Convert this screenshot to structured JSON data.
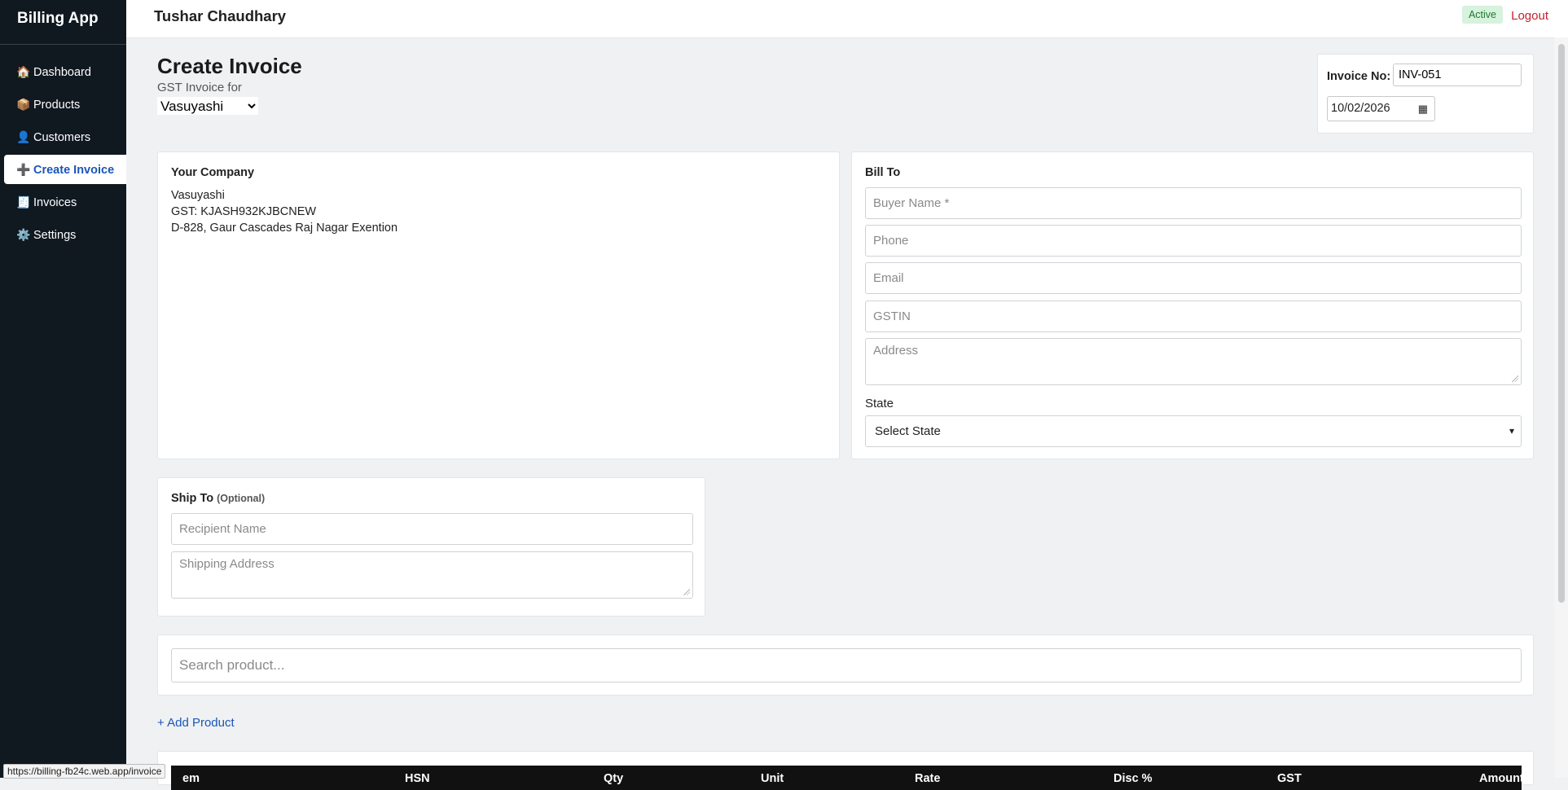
{
  "sidebar": {
    "brand": "Billing App",
    "items": [
      {
        "icon": "🏠",
        "label": "Dashboard"
      },
      {
        "icon": "📦",
        "label": "Products"
      },
      {
        "icon": "👤",
        "label": "Customers"
      },
      {
        "icon": "➕",
        "label": "Create Invoice"
      },
      {
        "icon": "🧾",
        "label": "Invoices"
      },
      {
        "icon": "⚙️",
        "label": "Settings"
      }
    ]
  },
  "header": {
    "user_name": "Tushar Chaudhary",
    "status": "Active",
    "logout_label": "Logout"
  },
  "page": {
    "title": "Create Invoice",
    "subtitle": "GST Invoice for",
    "company_selected": "Vasuyashi"
  },
  "invoice": {
    "number_label": "Invoice No:",
    "number": "INV-051",
    "date": "10/02/2026"
  },
  "your_company": {
    "heading": "Your Company",
    "name": "Vasuyashi",
    "gst": "GST: KJASH932KJBCNEW",
    "address": "D-828, Gaur Cascades Raj Nagar Exention"
  },
  "bill_to": {
    "heading": "Bill To",
    "buyer_placeholder": "Buyer Name *",
    "phone_placeholder": "Phone",
    "email_placeholder": "Email",
    "gstin_placeholder": "GSTIN",
    "address_placeholder": "Address",
    "state_label": "State",
    "state_selected": "Select State"
  },
  "ship_to": {
    "heading": "Ship To",
    "optional": "(Optional)",
    "recipient_placeholder": "Recipient Name",
    "address_placeholder": "Shipping Address"
  },
  "search": {
    "placeholder": "Search product..."
  },
  "add_product_label": "+ Add Product",
  "table": {
    "columns": [
      "em",
      "HSN",
      "Qty",
      "Unit",
      "Rate",
      "Disc %",
      "GST",
      "Amount"
    ]
  },
  "status_bar_url": "https://billing-fb24c.web.app/invoice",
  "colors": {
    "sidebar_bg": "#101820",
    "accent": "#1a56b8",
    "logout": "#c0242d",
    "status_bg": "#d7f2dd"
  }
}
